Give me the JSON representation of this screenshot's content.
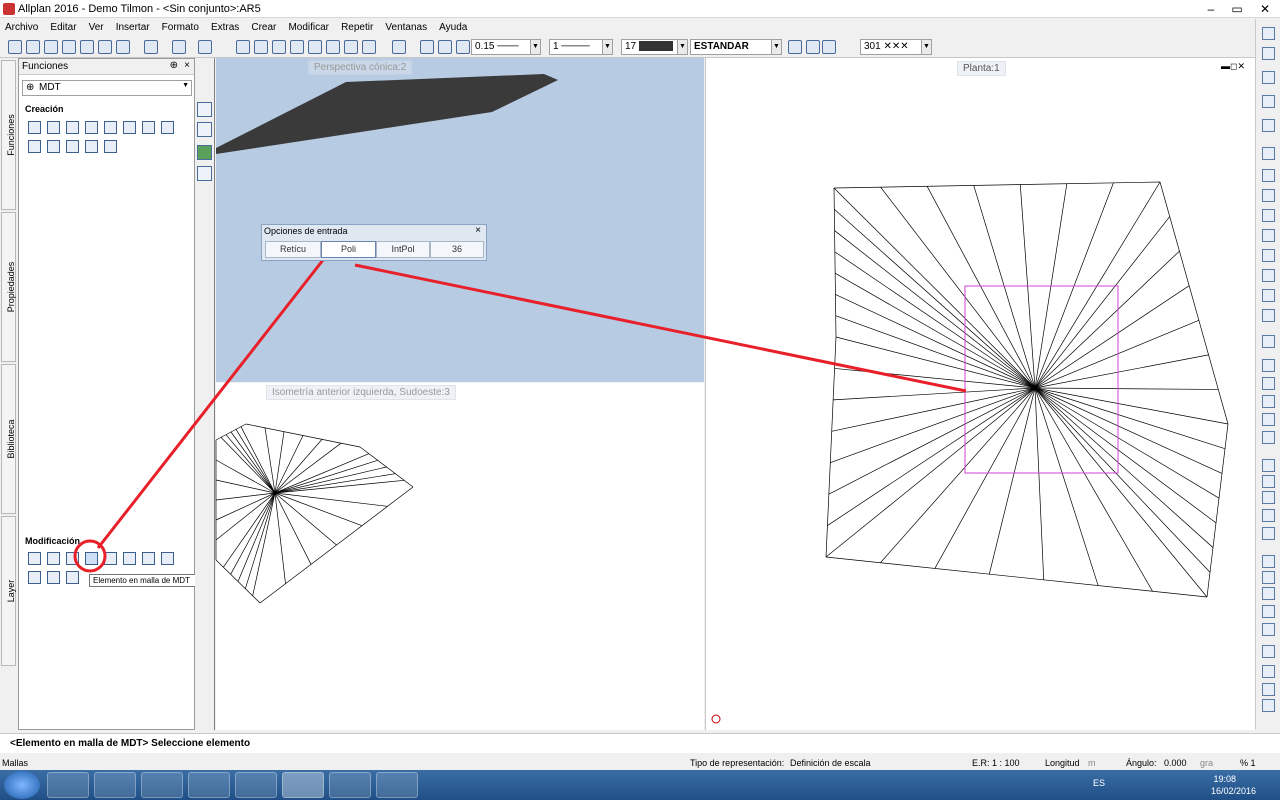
{
  "window": {
    "title": "Allplan 2016 - Demo Tilmon - <Sin conjunto>:AR5"
  },
  "menu": [
    "Archivo",
    "Editar",
    "Ver",
    "Insertar",
    "Formato",
    "Extras",
    "Crear",
    "Modificar",
    "Repetir",
    "Ventanas",
    "Ayuda"
  ],
  "toolbar": {
    "pen": "0.15",
    "line": "1",
    "color": "17",
    "layer": "ESTANDAR",
    "pattern": "301"
  },
  "left_tabs": [
    "Funciones",
    "Propiedades",
    "Biblioteca",
    "Layer"
  ],
  "panel": {
    "title": "Funciones",
    "module": "MDT",
    "section_create": "Creación",
    "section_modify": "Modificación",
    "tooltip": "Elemento en malla de MDT"
  },
  "views": {
    "persp": "Perspectiva cónica:2",
    "iso": "Isometría anterior izquierda, Sudoeste:3",
    "plan": "Planta:1"
  },
  "input_options": {
    "title": "Opciones de entrada",
    "buttons": [
      "Retícu",
      "Poli",
      "IntPol",
      "36"
    ]
  },
  "command_line": "<Elemento en malla de MDT> Seleccione elemento",
  "status": {
    "left": "Mallas",
    "rep_label": "Tipo de representación:",
    "rep_value": "Definición de escala",
    "scale": "E.R: 1 : 100",
    "length_label": "Longitud",
    "length_unit": "m",
    "angle_label": "Ángulo:",
    "angle_value": "0.000",
    "angle_unit": "gra",
    "percent": "% 1"
  },
  "tray": {
    "lang": "ES",
    "time": "19:08",
    "date": "16/02/2016"
  },
  "colors": {
    "annotation": "#e8202a",
    "selection": "#d040d0",
    "view_bg": "#b7cbe3"
  }
}
